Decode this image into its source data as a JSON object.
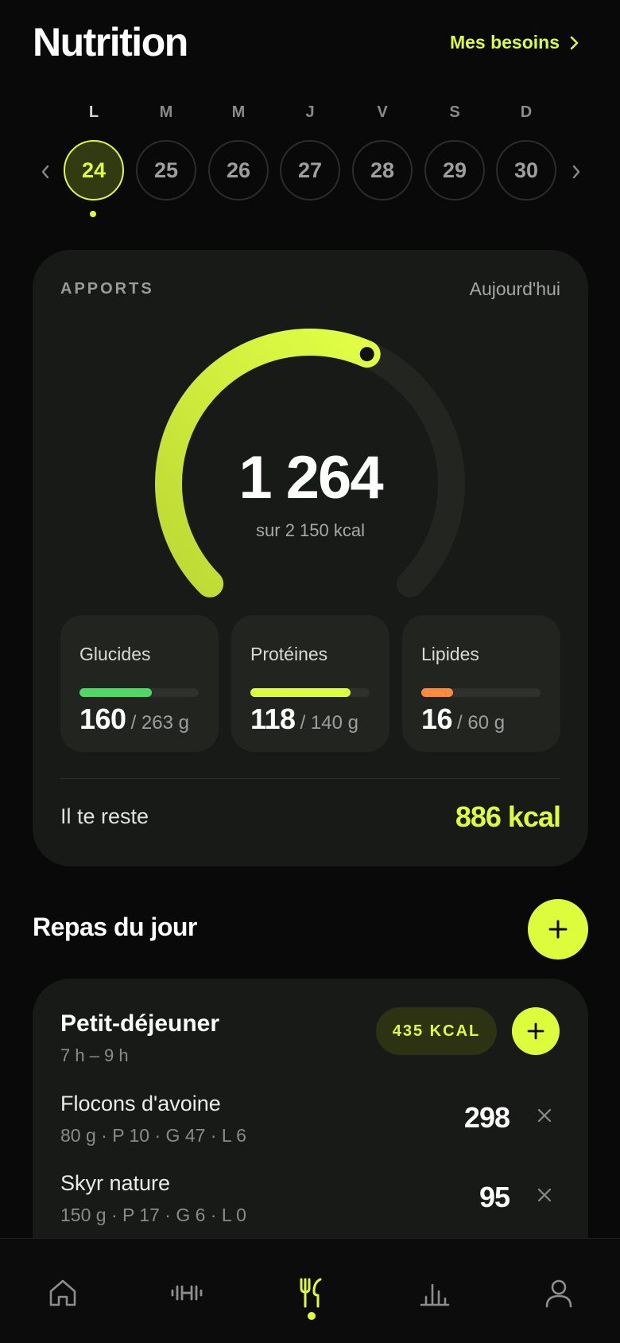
{
  "header": {
    "title": "Nutrition",
    "needs_link": "Mes besoins",
    "needs_icon": "chevron-right-icon"
  },
  "week": {
    "prev_icon": "chevron-left-icon",
    "next_icon": "chevron-right-icon",
    "days": [
      {
        "dow": "L",
        "num": "24",
        "active": true
      },
      {
        "dow": "M",
        "num": "25",
        "active": false
      },
      {
        "dow": "M",
        "num": "26",
        "active": false
      },
      {
        "dow": "J",
        "num": "27",
        "active": false
      },
      {
        "dow": "V",
        "num": "28",
        "active": false
      },
      {
        "dow": "S",
        "num": "29",
        "active": false
      },
      {
        "dow": "D",
        "num": "30",
        "active": false
      }
    ]
  },
  "intake": {
    "label": "APPORTS",
    "period": "Aujourd'hui",
    "consumed": "1 264",
    "target_text": "sur 2 150 kcal",
    "progress_fraction": 0.588,
    "macros": [
      {
        "name": "Glucides",
        "current": "160",
        "target_text": "/ 263 g",
        "fraction": 0.608,
        "color": "#4cd964"
      },
      {
        "name": "Protéines",
        "current": "118",
        "target_text": "/ 140 g",
        "fraction": 0.843,
        "color": "#dcfc3c"
      },
      {
        "name": "Lipides",
        "current": "16",
        "target_text": "/ 60 g",
        "fraction": 0.267,
        "color": "#ff8a3d"
      }
    ],
    "remaining_label": "Il te reste",
    "remaining_value": "886 kcal"
  },
  "meals_section": {
    "title": "Repas du jour",
    "add_icon": "plus-icon"
  },
  "meal": {
    "name": "Petit-déjeuner",
    "time": "7 h – 9 h",
    "badge": "435 KCAL",
    "add_icon": "plus-icon",
    "items": [
      {
        "name": "Flocons d'avoine",
        "detail": "80 g · P 10 · G 47 · L 6",
        "kcal": "298",
        "remove_icon": "close-icon"
      },
      {
        "name": "Skyr nature",
        "detail": "150 g · P 17 · G 6 · L 0",
        "kcal": "95",
        "remove_icon": "close-icon"
      }
    ]
  },
  "nav": {
    "items": [
      {
        "icon": "home-icon",
        "active": false
      },
      {
        "icon": "dumbbell-icon",
        "active": false
      },
      {
        "icon": "utensils-icon",
        "active": true
      },
      {
        "icon": "chart-icon",
        "active": false
      },
      {
        "icon": "user-icon",
        "active": false
      }
    ]
  },
  "colors": {
    "accent": "#dcfc3c",
    "background": "#090909",
    "card": "#181a17"
  }
}
